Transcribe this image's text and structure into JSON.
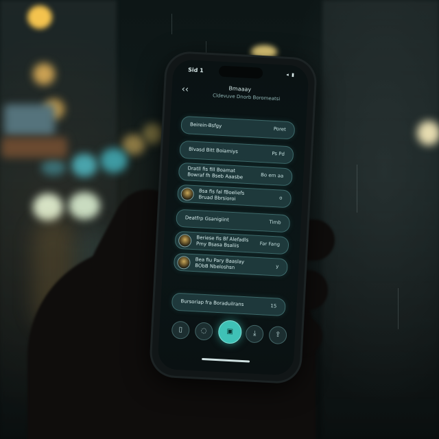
{
  "status_bar": {
    "time": "Sid 1",
    "icons": "◂ ▮"
  },
  "header": {
    "back_icon": "back-arrow-icon",
    "title": "Bmaaay",
    "subtitle": "Cldevuve Dnorb Boromeatsi"
  },
  "rows": [
    {
      "label": "Beirein-Bsfgy",
      "value": "Poret"
    },
    {
      "label": "Blvasd Bitt Boiamiys",
      "value": "Ps Pd"
    },
    {
      "label": "Dratll fis fill Boamat\nBowraf fh Bseb Aaasbe",
      "value": "Bo em aa"
    },
    {
      "label": "Bsa fis fal fBoeliefs\nBruad Bbrsioroi",
      "value": "o",
      "avatar": true
    },
    {
      "label": "Deatfrp Gsanigiint",
      "value": "Timb"
    },
    {
      "label": "Beriese fis Bf Alefadls\nPmy Bsasa Bsaliis",
      "value": "Far Fang",
      "avatar": true
    },
    {
      "label": "Bea fiu Pary Baaslay\nBObB Nbeloshsn",
      "value": "y",
      "avatar": true
    },
    {
      "label": "Bursoriap fra Boraduilrans",
      "value": "15"
    }
  ],
  "navbar": [
    {
      "name": "nav-bookmark-button",
      "icon": "bookmark-icon",
      "glyph": "▯"
    },
    {
      "name": "nav-refresh-button",
      "icon": "refresh-icon",
      "glyph": "◌"
    },
    {
      "name": "nav-home-button",
      "icon": "grid-icon",
      "glyph": "▣",
      "active": true
    },
    {
      "name": "nav-download-button",
      "icon": "download-icon",
      "glyph": "⤓"
    },
    {
      "name": "nav-share-button",
      "icon": "share-icon",
      "glyph": "⇪"
    }
  ],
  "colors": {
    "accent": "#3fc1b6",
    "row_bg": "#224042",
    "row_border": "#5a9696"
  }
}
